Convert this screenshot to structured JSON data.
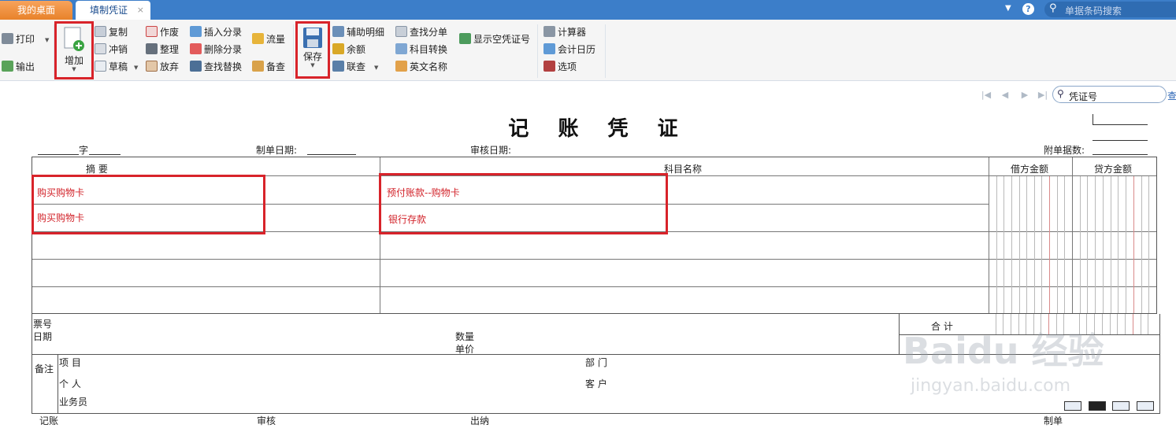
{
  "tabs": [
    {
      "label": "我的桌面"
    },
    {
      "label": "填制凭证",
      "close": "×"
    }
  ],
  "topbar": {
    "search_placeholder": "单据条码搜索",
    "help": "?",
    "dropdown": "▼"
  },
  "toolbar": {
    "print": "打印",
    "export": "输出",
    "add": "增加",
    "copy": "复制",
    "reverse": "冲销",
    "draft": "草稿",
    "void": "作废",
    "organize": "整理",
    "discard": "放弃",
    "insert_entry": "插入分录",
    "delete_entry": "删除分录",
    "find_replace": "查找替换",
    "cash_flow": "流量",
    "memo_check": "备查",
    "save": "保存",
    "aux_detail": "辅助明细",
    "balance": "余额",
    "linked_query": "联查",
    "find_entry": "查找分单",
    "account_convert": "科目转换",
    "english_name": "英文名称",
    "show_empty_no": "显示空凭证号",
    "calculator": "计算器",
    "accounting_calendar": "会计日历",
    "options": "选项"
  },
  "nav": {
    "search_text": "凭证号",
    "query": "查"
  },
  "voucher": {
    "title": "记 账 凭 证",
    "zi_label": "字",
    "date_label": "制单日期:",
    "audit_date_label": "审核日期:",
    "attachments_label": "附单据数:",
    "columns": {
      "summary": "摘 要",
      "account": "科目名称",
      "debit": "借方金额",
      "credit": "贷方金额"
    },
    "entries": [
      {
        "summary": "购买购物卡",
        "account": "预付账款--购物卡"
      },
      {
        "summary": "购买购物卡",
        "account": "银行存款"
      }
    ],
    "ticket_no": "票号",
    "date": "日期",
    "quantity": "数量",
    "unit_price": "单价",
    "total": "合 计",
    "remark": "备注",
    "project": "项  目",
    "department": "部  门",
    "person": "个  人",
    "customer": "客  户",
    "salesman": "业务员",
    "footer": {
      "bookkeeper": "记账",
      "auditor": "审核",
      "cashier": "出纳",
      "maker": "制单"
    }
  },
  "watermark": {
    "logo": "Baidu 经验",
    "url": "jingyan.baidu.com"
  },
  "colors": {
    "tab_bar": "#3c7ec9",
    "highlight": "#d8232a",
    "entry_text": "#d2232a"
  }
}
